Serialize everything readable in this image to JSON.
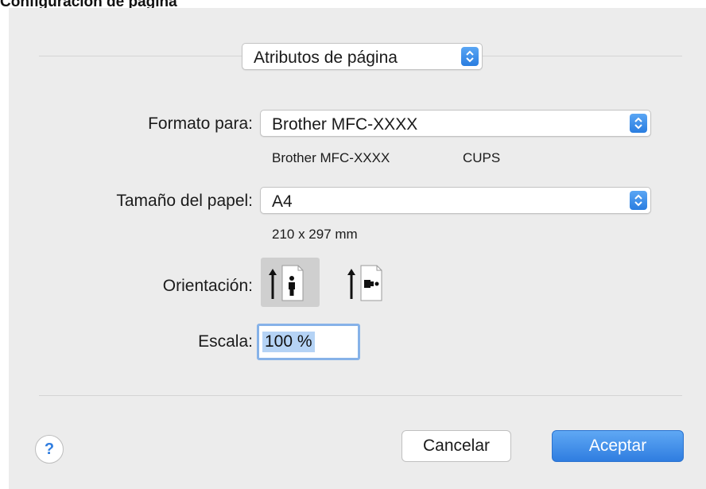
{
  "doc_title": "Configuración de página",
  "dialog": {
    "settings_popup": "Atributos de página",
    "format_for": {
      "label": "Formato para:",
      "value": "Brother MFC-XXXX",
      "printer_name": "Brother MFC-XXXX",
      "driver": "CUPS"
    },
    "paper_size": {
      "label": "Tamaño del papel:",
      "value": "A4",
      "dimensions": "210 x 297 mm"
    },
    "orientation": {
      "label": "Orientación:",
      "options": [
        "portrait",
        "landscape"
      ],
      "selected": "portrait"
    },
    "scale": {
      "label": "Escala:",
      "value": "100 %"
    },
    "help_symbol": "?",
    "buttons": {
      "cancel": "Cancelar",
      "ok": "Aceptar"
    }
  },
  "colors": {
    "accent": "#2f7de0",
    "selection": "#b5d3f5",
    "dialog_bg": "#ececec"
  },
  "icons": [
    "chevron-updown-icon",
    "portrait-orientation-icon",
    "landscape-orientation-icon",
    "help-icon"
  ]
}
